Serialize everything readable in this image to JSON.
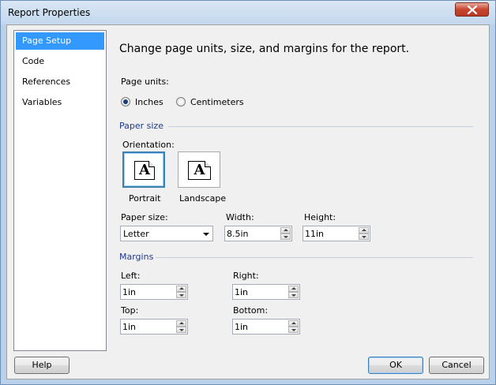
{
  "window": {
    "title": "Report Properties"
  },
  "nav": {
    "items": [
      {
        "label": "Page Setup",
        "selected": true
      },
      {
        "label": "Code",
        "selected": false
      },
      {
        "label": "References",
        "selected": false
      },
      {
        "label": "Variables",
        "selected": false
      }
    ]
  },
  "panel": {
    "heading": "Change page units, size, and margins for the report.",
    "page_units": {
      "label": "Page units:",
      "options": [
        {
          "label": "Inches",
          "checked": true
        },
        {
          "label": "Centimeters",
          "checked": false
        }
      ]
    },
    "paper_size_section": "Paper size",
    "orientation": {
      "label": "Orientation:",
      "portrait_label": "Portrait",
      "landscape_label": "Landscape",
      "glyph": "A",
      "selected": "Portrait"
    },
    "paper_size": {
      "label": "Paper size:",
      "value": "Letter"
    },
    "width": {
      "label": "Width:",
      "value": "8.5in"
    },
    "height": {
      "label": "Height:",
      "value": "11in"
    },
    "margins_section": "Margins",
    "margins": {
      "left": {
        "label": "Left:",
        "value": "1in"
      },
      "right": {
        "label": "Right:",
        "value": "1in"
      },
      "top": {
        "label": "Top:",
        "value": "1in"
      },
      "bottom": {
        "label": "Bottom:",
        "value": "1in"
      }
    }
  },
  "footer": {
    "help_label": "Help",
    "ok_label": "OK",
    "cancel_label": "Cancel"
  },
  "colors": {
    "selection": "#3399ff",
    "section_text": "#1e3a8a",
    "accent_border": "#3c7fb1"
  }
}
